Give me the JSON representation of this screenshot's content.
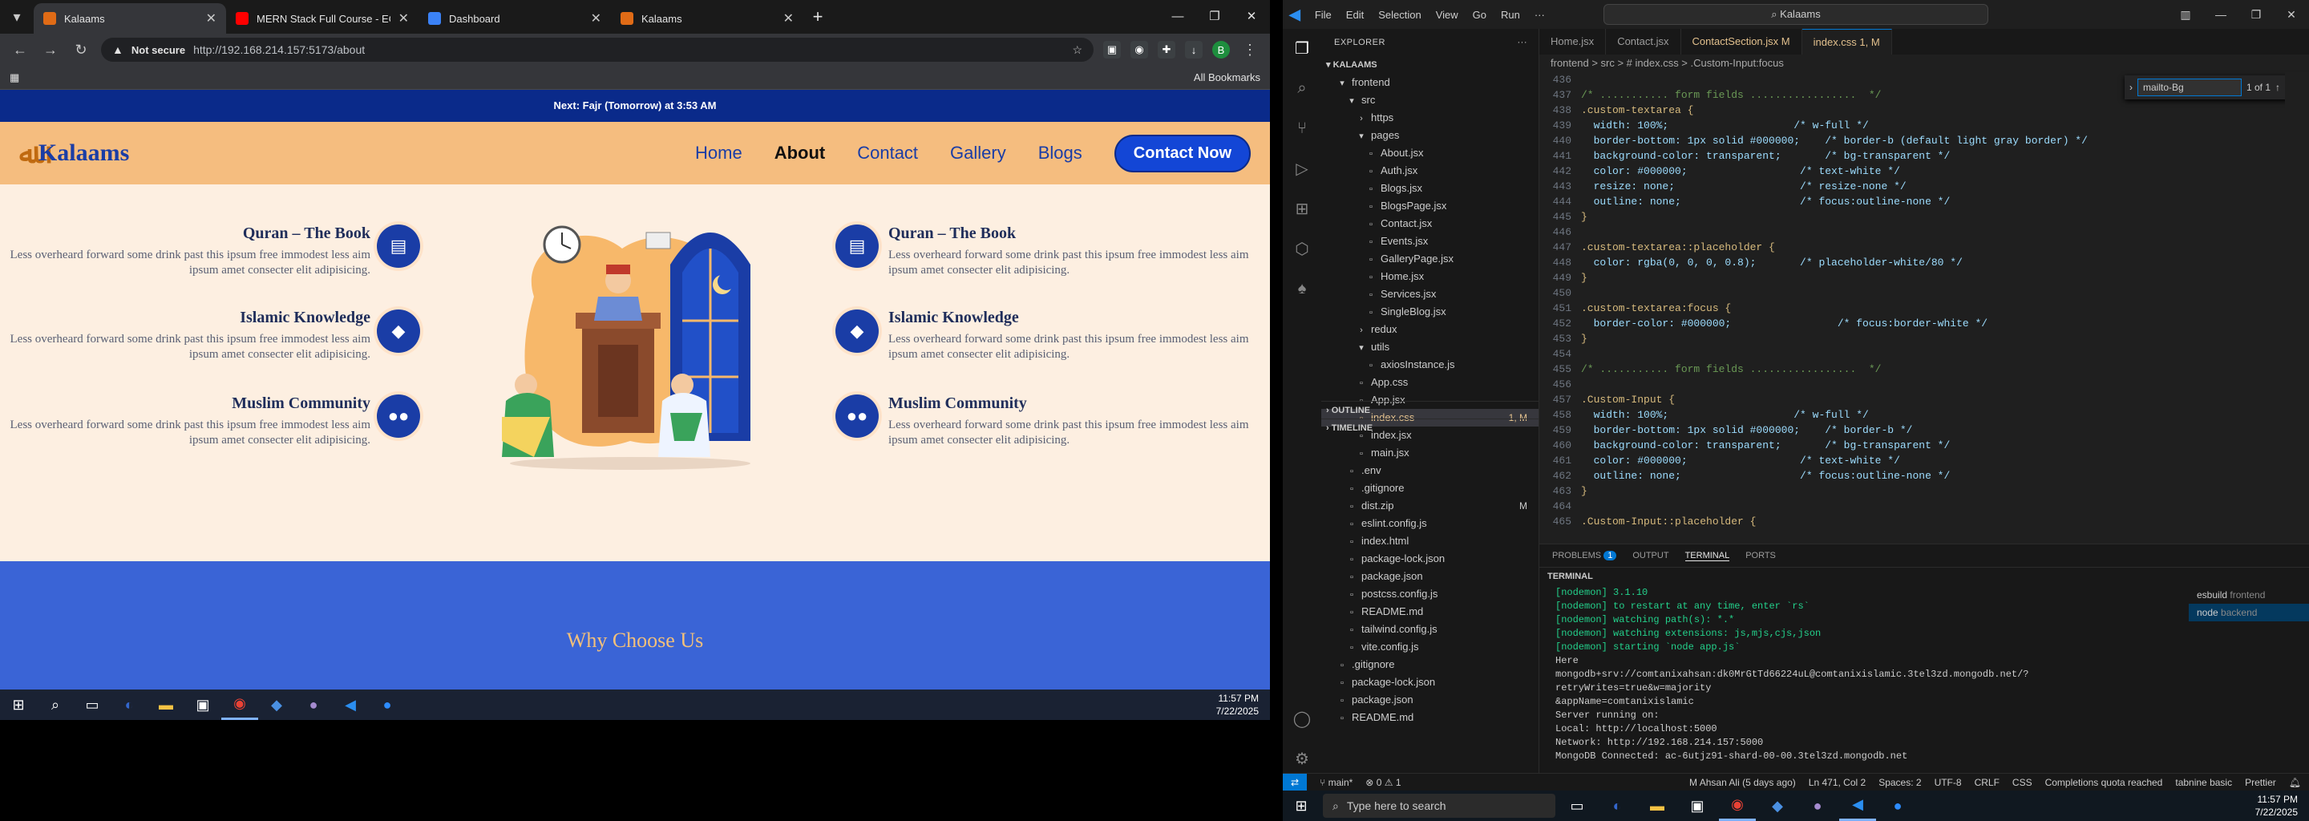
{
  "browser": {
    "tabs": [
      {
        "title": "Kalaams",
        "active": true,
        "icon_color": "#e06b16"
      },
      {
        "title": "MERN Stack Full Course - EComm",
        "active": false,
        "icon_color": "#ff0000"
      },
      {
        "title": "Dashboard",
        "active": false,
        "icon_color": "#3b82f6"
      },
      {
        "title": "Kalaams",
        "active": false,
        "icon_color": "#e06b16"
      }
    ],
    "new_tab": "+",
    "security": "Not secure",
    "url": "http://192.168.214.157:5173/about",
    "all_bookmarks": "All Bookmarks",
    "profile_initial": "B"
  },
  "site": {
    "prayer": "Next: Fajr (Tomorrow) at 3:53 AM",
    "logo": "Kalaams",
    "menu": [
      "Home",
      "About",
      "Contact",
      "Gallery",
      "Blogs"
    ],
    "current_menu": "About",
    "cta": "Contact Now",
    "features": [
      {
        "title": "Quran – The Book",
        "desc": "Less overheard forward some drink past this ipsum free immodest less aim ipsum amet consecter elit adipisicing."
      },
      {
        "title": "Islamic Knowledge",
        "desc": "Less overheard forward some drink past this ipsum free immodest less aim ipsum amet consecter elit adipisicing."
      },
      {
        "title": "Muslim Community",
        "desc": "Less overheard forward some drink past this ipsum free immodest less aim ipsum amet consecter elit adipisicing."
      }
    ],
    "section_title": "Why Choose Us"
  },
  "left_taskbar": {
    "time": "11:57 PM",
    "date": "7/22/2025"
  },
  "vscode": {
    "menu": [
      "File",
      "Edit",
      "Selection",
      "View",
      "Go",
      "Run"
    ],
    "search": "Kalaams",
    "explorer_label": "EXPLORER",
    "project": "KALAAMS",
    "tree": [
      {
        "label": "frontend",
        "depth": 1,
        "folder": true,
        "open": true
      },
      {
        "label": "src",
        "depth": 2,
        "folder": true,
        "open": true
      },
      {
        "label": "https",
        "depth": 3,
        "folder": true,
        "open": false
      },
      {
        "label": "pages",
        "depth": 3,
        "folder": true,
        "open": true
      },
      {
        "label": "About.jsx",
        "depth": 4
      },
      {
        "label": "Auth.jsx",
        "depth": 4
      },
      {
        "label": "Blogs.jsx",
        "depth": 4
      },
      {
        "label": "BlogsPage.jsx",
        "depth": 4
      },
      {
        "label": "Contact.jsx",
        "depth": 4
      },
      {
        "label": "Events.jsx",
        "depth": 4
      },
      {
        "label": "GalleryPage.jsx",
        "depth": 4
      },
      {
        "label": "Home.jsx",
        "depth": 4
      },
      {
        "label": "Services.jsx",
        "depth": 4
      },
      {
        "label": "SingleBlog.jsx",
        "depth": 4
      },
      {
        "label": "redux",
        "depth": 3,
        "folder": true,
        "open": false
      },
      {
        "label": "utils",
        "depth": 3,
        "folder": true,
        "open": true
      },
      {
        "label": "axiosInstance.js",
        "depth": 4
      },
      {
        "label": "App.css",
        "depth": 3
      },
      {
        "label": "App.jsx",
        "depth": 3
      },
      {
        "label": "index.css",
        "depth": 3,
        "selected": true,
        "badge": "1, M"
      },
      {
        "label": "index.jsx",
        "depth": 3
      },
      {
        "label": "main.jsx",
        "depth": 3
      },
      {
        "label": ".env",
        "depth": 2
      },
      {
        "label": ".gitignore",
        "depth": 2
      },
      {
        "label": "dist.zip",
        "depth": 2,
        "badge": "M"
      },
      {
        "label": "eslint.config.js",
        "depth": 2
      },
      {
        "label": "index.html",
        "depth": 2
      },
      {
        "label": "package-lock.json",
        "depth": 2
      },
      {
        "label": "package.json",
        "depth": 2
      },
      {
        "label": "postcss.config.js",
        "depth": 2
      },
      {
        "label": "README.md",
        "depth": 2
      },
      {
        "label": "tailwind.config.js",
        "depth": 2
      },
      {
        "label": "vite.config.js",
        "depth": 2
      },
      {
        "label": ".gitignore",
        "depth": 1
      },
      {
        "label": "package-lock.json",
        "depth": 1
      },
      {
        "label": "package.json",
        "depth": 1
      },
      {
        "label": "README.md",
        "depth": 1
      }
    ],
    "outline": "OUTLINE",
    "timeline": "TIMELINE",
    "editor_tabs": [
      "Home.jsx",
      "Contact.jsx",
      "ContactSection.jsx M",
      "index.css 1, M"
    ],
    "active_tab": "index.css 1, M",
    "breadcrumb": "frontend > src > # index.css > .Custom-Input:focus",
    "find": {
      "query": "mailto-Bg",
      "result": "1 of 1"
    },
    "code": [
      {
        "n": "436",
        "t": ""
      },
      {
        "n": "437",
        "t": "/* ........... form fields .................  */"
      },
      {
        "n": "438",
        "t": ".custom-textarea {"
      },
      {
        "n": "439",
        "t": "  width: 100%;                    /* w-full */"
      },
      {
        "n": "440",
        "t": "  border-bottom: 1px solid #000000;    /* border-b (default light gray border) */"
      },
      {
        "n": "441",
        "t": "  background-color: transparent;       /* bg-transparent */"
      },
      {
        "n": "442",
        "t": "  color: #000000;                  /* text-white */"
      },
      {
        "n": "443",
        "t": "  resize: none;                    /* resize-none */"
      },
      {
        "n": "444",
        "t": "  outline: none;                   /* focus:outline-none */"
      },
      {
        "n": "445",
        "t": "}"
      },
      {
        "n": "446",
        "t": ""
      },
      {
        "n": "447",
        "t": ".custom-textarea::placeholder {"
      },
      {
        "n": "448",
        "t": "  color: rgba(0, 0, 0, 0.8);       /* placeholder-white/80 */"
      },
      {
        "n": "449",
        "t": "}"
      },
      {
        "n": "450",
        "t": ""
      },
      {
        "n": "451",
        "t": ".custom-textarea:focus {"
      },
      {
        "n": "452",
        "t": "  border-color: #000000;                 /* focus:border-white */"
      },
      {
        "n": "453",
        "t": "}"
      },
      {
        "n": "454",
        "t": ""
      },
      {
        "n": "455",
        "t": "/* ........... form fields .................  */"
      },
      {
        "n": "456",
        "t": ""
      },
      {
        "n": "457",
        "t": ".Custom-Input {"
      },
      {
        "n": "458",
        "t": "  width: 100%;                    /* w-full */"
      },
      {
        "n": "459",
        "t": "  border-bottom: 1px solid #000000;    /* border-b */"
      },
      {
        "n": "460",
        "t": "  background-color: transparent;       /* bg-transparent */"
      },
      {
        "n": "461",
        "t": "  color: #000000;                  /* text-white */"
      },
      {
        "n": "462",
        "t": "  outline: none;                   /* focus:outline-none */"
      },
      {
        "n": "463",
        "t": "}"
      },
      {
        "n": "464",
        "t": ""
      },
      {
        "n": "465",
        "t": ".Custom-Input::placeholder {"
      }
    ],
    "panel_tabs": [
      "PROBLEMS",
      "OUTPUT",
      "TERMINAL",
      "PORTS"
    ],
    "problems_count": "1",
    "active_panel": "TERMINAL",
    "terminal_label": "TERMINAL",
    "terminal": [
      "[nodemon] 3.1.10",
      "[nodemon] to restart at any time, enter `rs`",
      "[nodemon] watching path(s): *.*",
      "[nodemon] watching extensions: js,mjs,cjs,json",
      "[nodemon] starting `node app.js`",
      "Here",
      "mongodb+srv://comtanixahsan:dk0MrGtTd66224uL@comtanixislamic.3tel3zd.mongodb.net/?retryWrites=true&w=majority",
      "&appName=comtanixislamic",
      "Server running on:",
      "  Local: http://localhost:5000",
      "  Network: http://192.168.214.157:5000",
      "MongoDB Connected: ac-6utjz91-shard-00-00.3tel3zd.mongodb.net"
    ],
    "processes": [
      {
        "name": "esbuild",
        "sub": "frontend"
      },
      {
        "name": "node",
        "sub": "backend"
      }
    ],
    "status": {
      "branch": "main*",
      "errors": "0",
      "warnings": "1",
      "blame": "M Ahsan Ali (5 days ago)",
      "position": "Ln 471, Col 2",
      "spaces": "Spaces: 2",
      "encoding": "UTF-8",
      "eol": "CRLF",
      "lang": "CSS",
      "completions": "Completions quota reached",
      "tabnine": "tabnine basic",
      "prettier": "Prettier"
    }
  },
  "win_taskbar": {
    "search": "Type here to search",
    "time": "11:57 PM",
    "date": "7/22/2025"
  }
}
